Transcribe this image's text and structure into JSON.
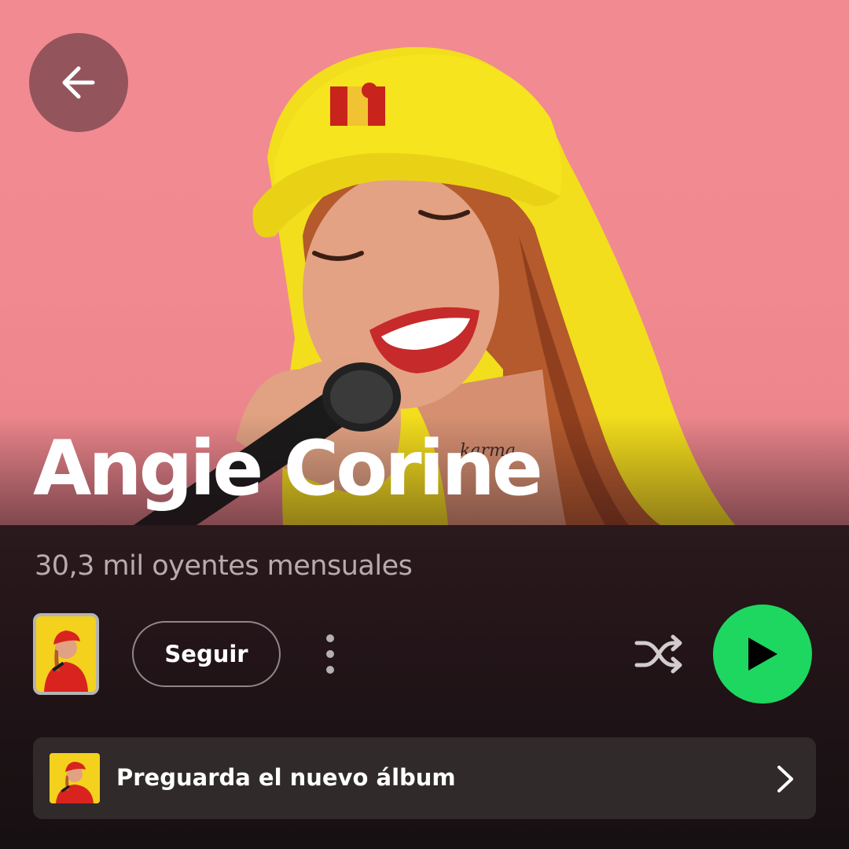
{
  "artist": {
    "name": "Angie Corine",
    "monthly_listeners": "30,3 mil oyentes mensuales"
  },
  "actions": {
    "follow_label": "Seguir"
  },
  "presave": {
    "label": "Preguarda el nuevo álbum"
  },
  "icons": {
    "back": "arrow-left-icon",
    "more": "more-vertical-icon",
    "shuffle": "shuffle-icon",
    "play": "play-icon",
    "chevron": "chevron-right-icon"
  },
  "colors": {
    "hero_background": "#f08a90",
    "play_accent": "#1ed760",
    "cap_yellow": "#f4e21a",
    "card_background": "#302a2b",
    "secondary_text": "#b7abad"
  }
}
